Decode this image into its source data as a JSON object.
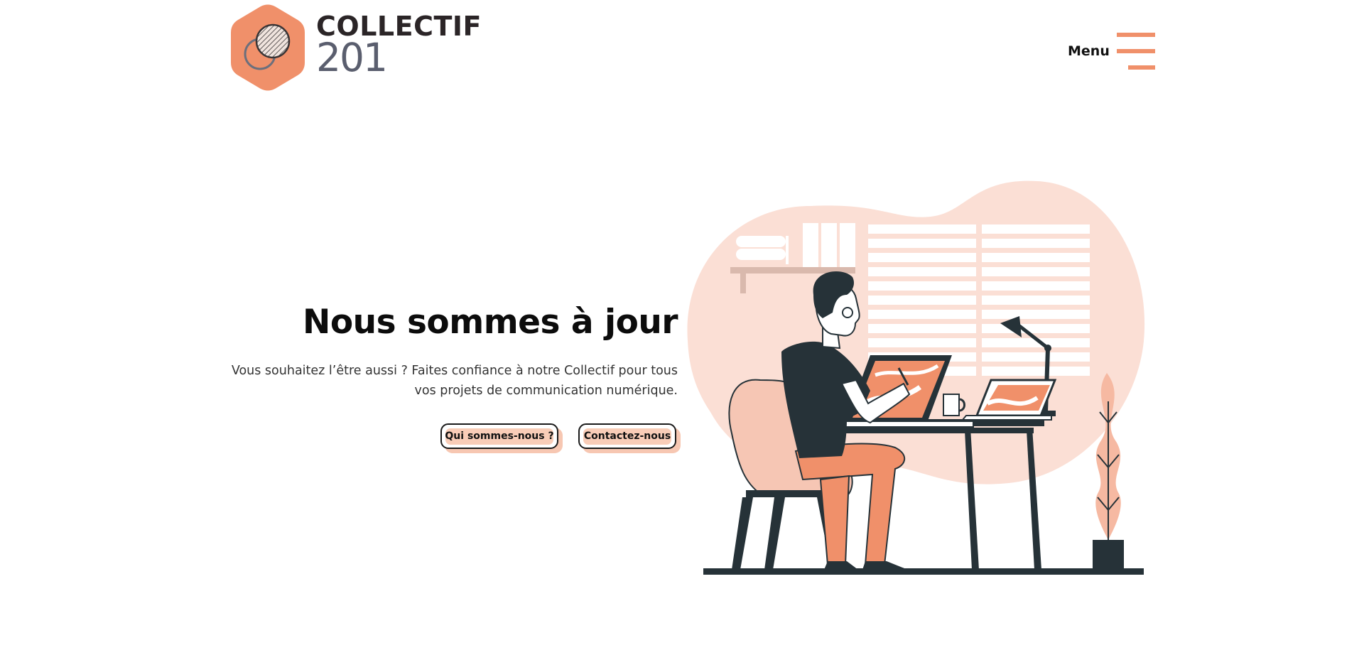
{
  "header": {
    "logo": {
      "word": "COLLECTIF",
      "number": "201"
    },
    "menu_label": "Menu"
  },
  "hero": {
    "title": "Nous sommes à jour",
    "description": "Vous souhaitez l’être aussi ? Faites confiance à notre Collectif pour tous vos projets de communication numérique.",
    "buttons": {
      "about": "Qui sommes-nous ?",
      "contact": "Contactez-nous"
    }
  },
  "colors": {
    "accent": "#f0906a",
    "accent_light": "#f9cdb8",
    "blob": "#fbdfd5",
    "dark": "#263238"
  },
  "icons": [
    "logo-hexagon-icon",
    "hamburger-menu-icon"
  ]
}
